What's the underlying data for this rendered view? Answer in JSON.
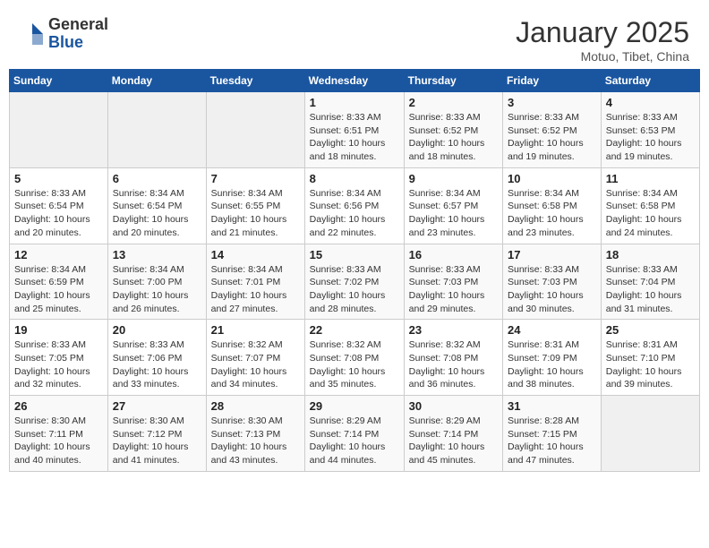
{
  "header": {
    "logo_general": "General",
    "logo_blue": "Blue",
    "month_title": "January 2025",
    "location": "Motuo, Tibet, China"
  },
  "weekdays": [
    "Sunday",
    "Monday",
    "Tuesday",
    "Wednesday",
    "Thursday",
    "Friday",
    "Saturday"
  ],
  "weeks": [
    [
      {
        "day": "",
        "info": ""
      },
      {
        "day": "",
        "info": ""
      },
      {
        "day": "",
        "info": ""
      },
      {
        "day": "1",
        "info": "Sunrise: 8:33 AM\nSunset: 6:51 PM\nDaylight: 10 hours\nand 18 minutes."
      },
      {
        "day": "2",
        "info": "Sunrise: 8:33 AM\nSunset: 6:52 PM\nDaylight: 10 hours\nand 18 minutes."
      },
      {
        "day": "3",
        "info": "Sunrise: 8:33 AM\nSunset: 6:52 PM\nDaylight: 10 hours\nand 19 minutes."
      },
      {
        "day": "4",
        "info": "Sunrise: 8:33 AM\nSunset: 6:53 PM\nDaylight: 10 hours\nand 19 minutes."
      }
    ],
    [
      {
        "day": "5",
        "info": "Sunrise: 8:33 AM\nSunset: 6:54 PM\nDaylight: 10 hours\nand 20 minutes."
      },
      {
        "day": "6",
        "info": "Sunrise: 8:34 AM\nSunset: 6:54 PM\nDaylight: 10 hours\nand 20 minutes."
      },
      {
        "day": "7",
        "info": "Sunrise: 8:34 AM\nSunset: 6:55 PM\nDaylight: 10 hours\nand 21 minutes."
      },
      {
        "day": "8",
        "info": "Sunrise: 8:34 AM\nSunset: 6:56 PM\nDaylight: 10 hours\nand 22 minutes."
      },
      {
        "day": "9",
        "info": "Sunrise: 8:34 AM\nSunset: 6:57 PM\nDaylight: 10 hours\nand 23 minutes."
      },
      {
        "day": "10",
        "info": "Sunrise: 8:34 AM\nSunset: 6:58 PM\nDaylight: 10 hours\nand 23 minutes."
      },
      {
        "day": "11",
        "info": "Sunrise: 8:34 AM\nSunset: 6:58 PM\nDaylight: 10 hours\nand 24 minutes."
      }
    ],
    [
      {
        "day": "12",
        "info": "Sunrise: 8:34 AM\nSunset: 6:59 PM\nDaylight: 10 hours\nand 25 minutes."
      },
      {
        "day": "13",
        "info": "Sunrise: 8:34 AM\nSunset: 7:00 PM\nDaylight: 10 hours\nand 26 minutes."
      },
      {
        "day": "14",
        "info": "Sunrise: 8:34 AM\nSunset: 7:01 PM\nDaylight: 10 hours\nand 27 minutes."
      },
      {
        "day": "15",
        "info": "Sunrise: 8:33 AM\nSunset: 7:02 PM\nDaylight: 10 hours\nand 28 minutes."
      },
      {
        "day": "16",
        "info": "Sunrise: 8:33 AM\nSunset: 7:03 PM\nDaylight: 10 hours\nand 29 minutes."
      },
      {
        "day": "17",
        "info": "Sunrise: 8:33 AM\nSunset: 7:03 PM\nDaylight: 10 hours\nand 30 minutes."
      },
      {
        "day": "18",
        "info": "Sunrise: 8:33 AM\nSunset: 7:04 PM\nDaylight: 10 hours\nand 31 minutes."
      }
    ],
    [
      {
        "day": "19",
        "info": "Sunrise: 8:33 AM\nSunset: 7:05 PM\nDaylight: 10 hours\nand 32 minutes."
      },
      {
        "day": "20",
        "info": "Sunrise: 8:33 AM\nSunset: 7:06 PM\nDaylight: 10 hours\nand 33 minutes."
      },
      {
        "day": "21",
        "info": "Sunrise: 8:32 AM\nSunset: 7:07 PM\nDaylight: 10 hours\nand 34 minutes."
      },
      {
        "day": "22",
        "info": "Sunrise: 8:32 AM\nSunset: 7:08 PM\nDaylight: 10 hours\nand 35 minutes."
      },
      {
        "day": "23",
        "info": "Sunrise: 8:32 AM\nSunset: 7:08 PM\nDaylight: 10 hours\nand 36 minutes."
      },
      {
        "day": "24",
        "info": "Sunrise: 8:31 AM\nSunset: 7:09 PM\nDaylight: 10 hours\nand 38 minutes."
      },
      {
        "day": "25",
        "info": "Sunrise: 8:31 AM\nSunset: 7:10 PM\nDaylight: 10 hours\nand 39 minutes."
      }
    ],
    [
      {
        "day": "26",
        "info": "Sunrise: 8:30 AM\nSunset: 7:11 PM\nDaylight: 10 hours\nand 40 minutes."
      },
      {
        "day": "27",
        "info": "Sunrise: 8:30 AM\nSunset: 7:12 PM\nDaylight: 10 hours\nand 41 minutes."
      },
      {
        "day": "28",
        "info": "Sunrise: 8:30 AM\nSunset: 7:13 PM\nDaylight: 10 hours\nand 43 minutes."
      },
      {
        "day": "29",
        "info": "Sunrise: 8:29 AM\nSunset: 7:14 PM\nDaylight: 10 hours\nand 44 minutes."
      },
      {
        "day": "30",
        "info": "Sunrise: 8:29 AM\nSunset: 7:14 PM\nDaylight: 10 hours\nand 45 minutes."
      },
      {
        "day": "31",
        "info": "Sunrise: 8:28 AM\nSunset: 7:15 PM\nDaylight: 10 hours\nand 47 minutes."
      },
      {
        "day": "",
        "info": ""
      }
    ]
  ]
}
